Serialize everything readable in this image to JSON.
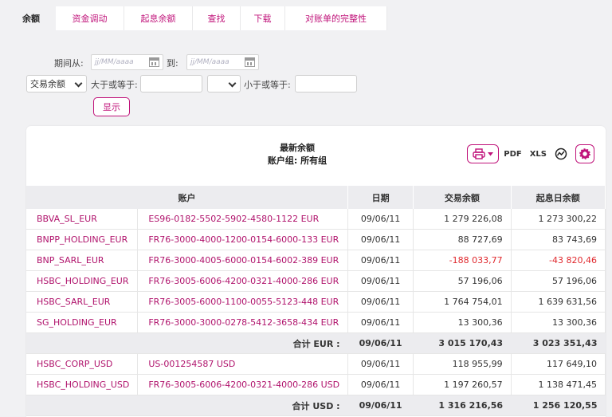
{
  "tabs": [
    {
      "label": "余额",
      "active": true
    },
    {
      "label": "资金调动",
      "active": false
    },
    {
      "label": "起息余额",
      "active": false
    },
    {
      "label": "查找",
      "active": false
    },
    {
      "label": "下载",
      "active": false
    },
    {
      "label": "对账单的完整性",
      "active": false
    }
  ],
  "filters": {
    "period_from_label": "期间从:",
    "date_from_placeholder": "jj/MM/aaaa",
    "to_label": "到:",
    "date_to_placeholder": "jj/MM/aaaa",
    "balance_type_value": "交易余额",
    "gte_label": "大于或等于:",
    "lte_label": "小于或等于:",
    "show_button": "显示"
  },
  "panel": {
    "title": "最新余额",
    "subtitle": "账户组: 所有组",
    "pdf_label": "PDF",
    "xls_label": "XLS"
  },
  "table": {
    "headers": [
      "账户",
      "日期",
      "交易余额",
      "起息日余额"
    ],
    "groups": [
      {
        "rows": [
          {
            "account": "BBVA_SL_EUR",
            "iban": "ES96-0182-5502-5902-4580-1122 EUR",
            "date": "09/06/11",
            "trade": "1 279 226,08",
            "value": "1 273 300,22",
            "neg_trade": false,
            "neg_value": false
          },
          {
            "account": "BNPP_HOLDING_EUR",
            "iban": "FR76-3000-4000-1200-0154-6000-133 EUR",
            "date": "09/06/11",
            "trade": "88 727,69",
            "value": "83 743,69",
            "neg_trade": false,
            "neg_value": false
          },
          {
            "account": "BNP_SARL_EUR",
            "iban": "FR76-3000-4005-6000-0154-6002-389 EUR",
            "date": "09/06/11",
            "trade": "-188 033,77",
            "value": "-43 820,46",
            "neg_trade": true,
            "neg_value": true
          },
          {
            "account": "HSBC_HOLDING_EUR",
            "iban": "FR76-3005-6006-4200-0321-4000-286 EUR",
            "date": "09/06/11",
            "trade": "57 196,06",
            "value": "57 196,06",
            "neg_trade": false,
            "neg_value": false
          },
          {
            "account": "HSBC_SARL_EUR",
            "iban": "FR76-3005-6000-1100-0055-5123-448 EUR",
            "date": "09/06/11",
            "trade": "1 764 754,01",
            "value": "1 639 631,56",
            "neg_trade": false,
            "neg_value": false
          },
          {
            "account": "SG_HOLDING_EUR",
            "iban": "FR76-3000-3000-0278-5412-3658-434 EUR",
            "date": "09/06/11",
            "trade": "13 300,36",
            "value": "13 300,36",
            "neg_trade": false,
            "neg_value": false
          }
        ],
        "total": {
          "label": "合计 EUR :",
          "date": "09/06/11",
          "trade": "3 015 170,43",
          "value": "3 023 351,43"
        }
      },
      {
        "rows": [
          {
            "account": "HSBC_CORP_USD",
            "iban": "US-001254587 USD",
            "date": "09/06/11",
            "trade": "118 955,99",
            "value": "117 649,10",
            "neg_trade": false,
            "neg_value": false
          },
          {
            "account": "HSBC_HOLDING_USD",
            "iban": "FR76-3005-6006-4200-0321-4000-286 USD",
            "date": "09/06/11",
            "trade": "1 197 260,57",
            "value": "1 138 471,45",
            "neg_trade": false,
            "neg_value": false
          }
        ],
        "total": {
          "label": "合计 USD :",
          "date": "09/06/11",
          "trade": "1 316 216,56",
          "value": "1 256 120,55"
        }
      }
    ]
  },
  "colors": {
    "accent": "#c0137a",
    "negative": "#e0282d",
    "header_bg": "#ececef"
  }
}
